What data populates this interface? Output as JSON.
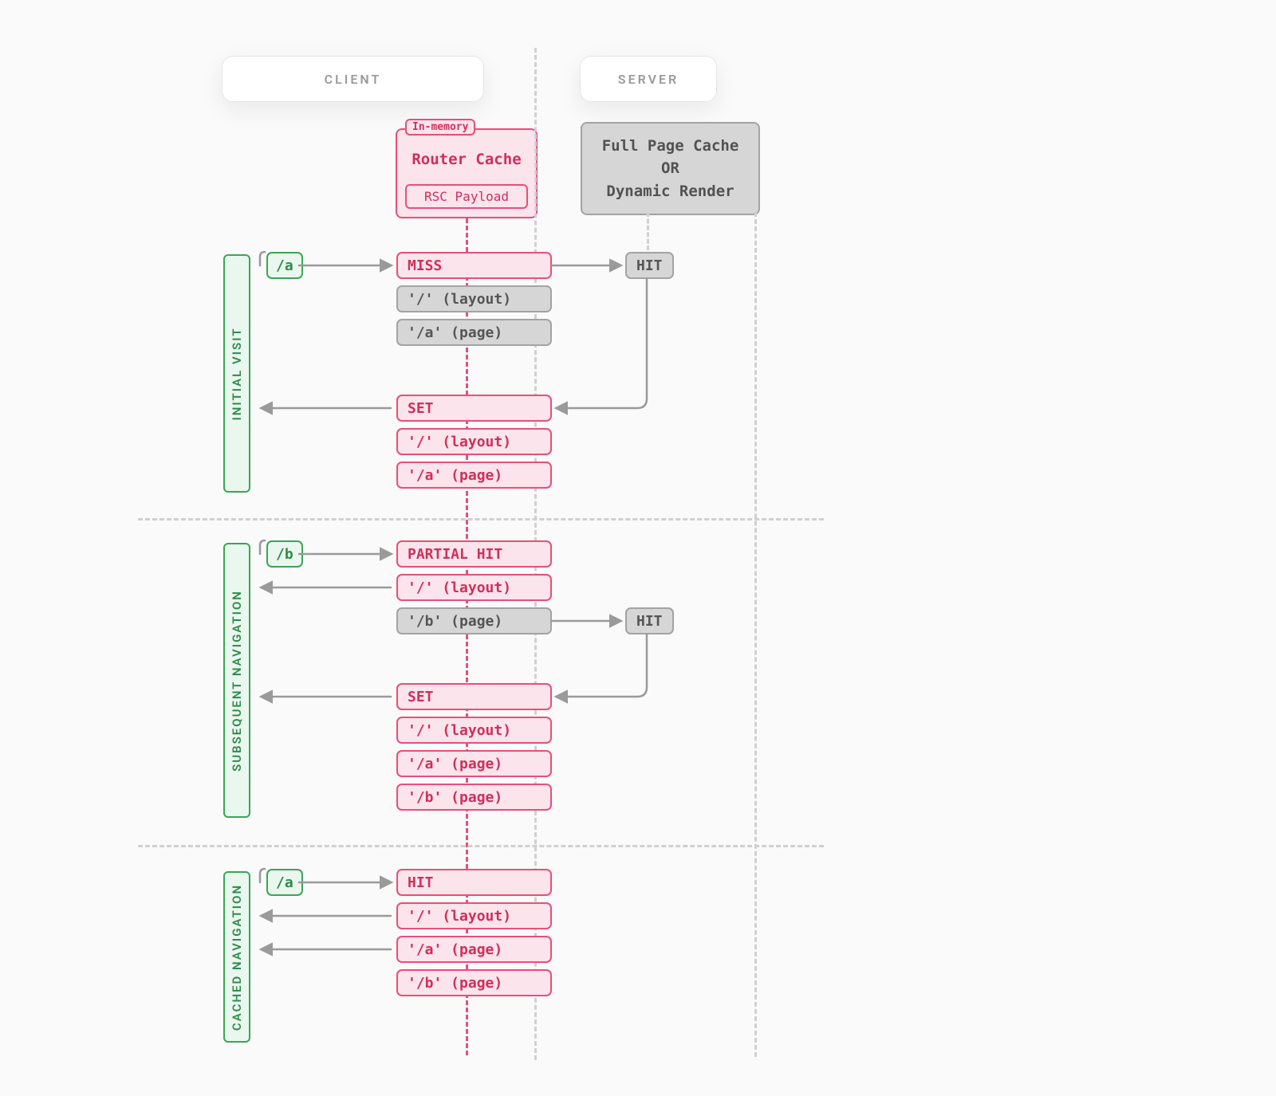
{
  "header": {
    "client": "CLIENT",
    "server": "SERVER"
  },
  "router_cache": {
    "tag": "In-memory",
    "title": "Router Cache",
    "sub": "RSC Payload"
  },
  "server_box": "Full Page Cache\nOR\nDynamic Render",
  "sections": {
    "initial": {
      "label": "INITIAL VISIT",
      "route": "/a",
      "rows": [
        "MISS",
        "'/' (layout)",
        "'/a' (page)",
        "SET",
        "'/' (layout)",
        "'/a' (page)"
      ],
      "server_hit": "HIT"
    },
    "subsequent": {
      "label": "SUBSEQUENT NAVIGATION",
      "route": "/b",
      "rows": [
        "PARTIAL HIT",
        "'/' (layout)",
        "'/b' (page)",
        "SET",
        "'/' (layout)",
        "'/a' (page)",
        "'/b' (page)"
      ],
      "server_hit": "HIT"
    },
    "cached": {
      "label": "CACHED NAVIGATION",
      "route": "/a",
      "rows": [
        "HIT",
        "'/' (layout)",
        "'/a' (page)",
        "'/b' (page)"
      ]
    }
  }
}
